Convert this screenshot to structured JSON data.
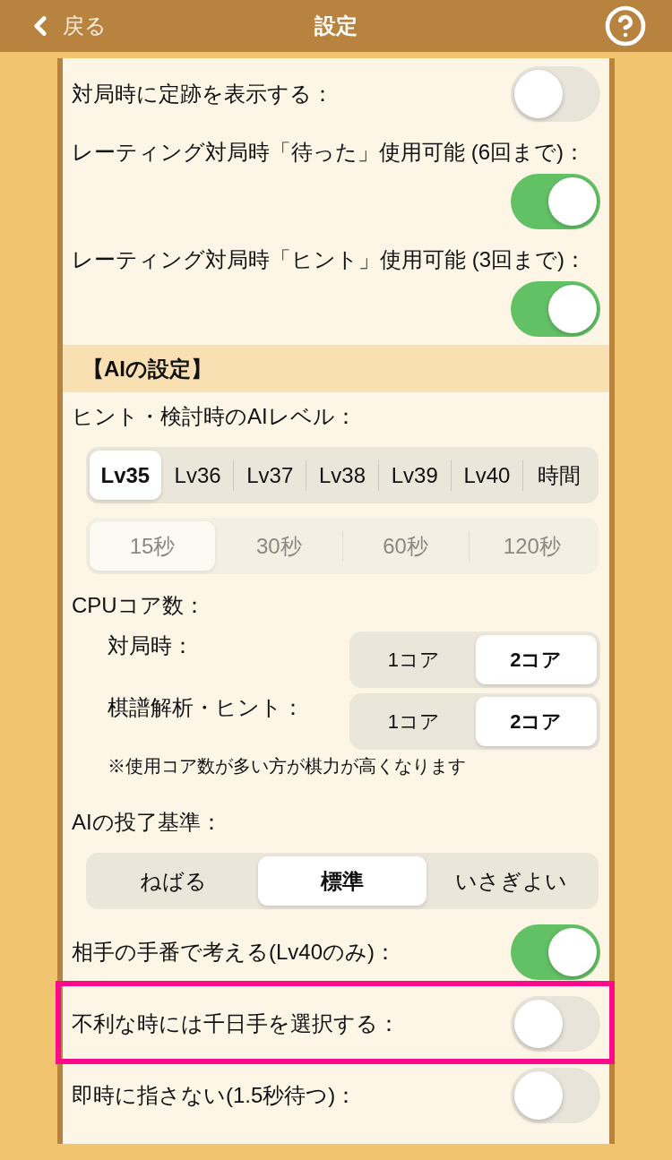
{
  "header": {
    "back_label": "戻る",
    "title": "設定"
  },
  "settings": [
    {
      "kind": "toggle",
      "label": "対局時に定跡を表示する：",
      "on": false,
      "highlighted": false
    },
    {
      "kind": "toggle",
      "label": "レーティング対局時「待った」使用可能 (6回まで)：",
      "on": true,
      "highlighted": false
    },
    {
      "kind": "toggle",
      "label": "レーティング対局時「ヒント」使用可能 (3回まで)：",
      "on": true,
      "highlighted": false
    },
    {
      "kind": "section",
      "title": "【AIの設定】"
    },
    {
      "kind": "heading",
      "label": "ヒント・検討時のAIレベル："
    },
    {
      "kind": "segmented",
      "disabled": false,
      "options": [
        {
          "label": "Lv35",
          "selected": true
        },
        {
          "label": "Lv36",
          "selected": false
        },
        {
          "label": "Lv37",
          "selected": false
        },
        {
          "label": "Lv38",
          "selected": false
        },
        {
          "label": "Lv39",
          "selected": false
        },
        {
          "label": "Lv40",
          "selected": false
        },
        {
          "label": "時間",
          "selected": false
        }
      ]
    },
    {
      "kind": "segmented",
      "disabled": true,
      "options": [
        {
          "label": "15秒",
          "selected": true
        },
        {
          "label": "30秒",
          "selected": false
        },
        {
          "label": "60秒",
          "selected": false
        },
        {
          "label": "120秒",
          "selected": false
        }
      ]
    },
    {
      "kind": "heading",
      "label": "CPUコア数："
    },
    {
      "kind": "labeled_segmented",
      "label": "対局時：",
      "options": [
        {
          "label": "1コア",
          "selected": false
        },
        {
          "label": "2コア",
          "selected": true
        }
      ]
    },
    {
      "kind": "labeled_segmented",
      "label": "棋譜解析・ヒント：",
      "options": [
        {
          "label": "1コア",
          "selected": false
        },
        {
          "label": "2コア",
          "selected": true
        }
      ]
    },
    {
      "kind": "note",
      "text": "※使用コア数が多い方が棋力が高くなります"
    },
    {
      "kind": "heading",
      "label": "AIの投了基準："
    },
    {
      "kind": "segmented",
      "disabled": false,
      "options": [
        {
          "label": "ねばる",
          "selected": false
        },
        {
          "label": "標準",
          "selected": true
        },
        {
          "label": "いさぎよい",
          "selected": false
        }
      ]
    },
    {
      "kind": "toggle",
      "label": "相手の手番で考える(Lv40のみ)：",
      "on": true,
      "highlighted": false
    },
    {
      "kind": "toggle",
      "label": "不利な時には千日手を選択する：",
      "on": false,
      "highlighted": true
    },
    {
      "kind": "toggle",
      "label": "即時に指さない(1.5秒待つ)：",
      "on": false,
      "highlighted": false
    }
  ]
}
